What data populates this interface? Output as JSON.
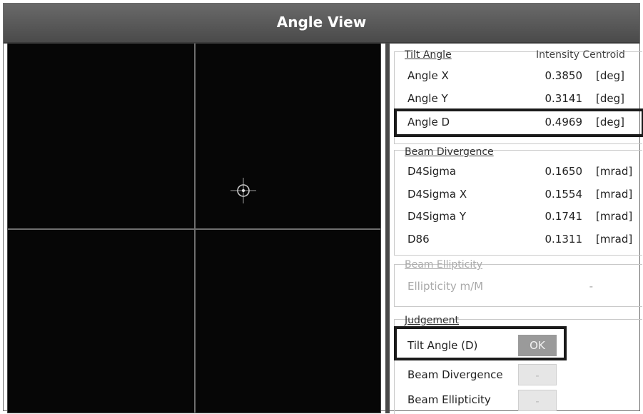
{
  "window": {
    "title": "Angle View"
  },
  "tilt_angle": {
    "group_title": "Tilt Angle",
    "method": "Intensity Centroid",
    "rows": [
      {
        "label": "Angle X",
        "value": "0.3850",
        "unit": "[deg]"
      },
      {
        "label": "Angle Y",
        "value": "0.3141",
        "unit": "[deg]"
      },
      {
        "label": "Angle D",
        "value": "0.4969",
        "unit": "[deg]"
      }
    ]
  },
  "beam_divergence": {
    "group_title": "Beam Divergence",
    "rows": [
      {
        "label": "D4Sigma",
        "value": "0.1650",
        "unit": "[mrad]"
      },
      {
        "label": "D4Sigma X",
        "value": "0.1554",
        "unit": "[mrad]"
      },
      {
        "label": "D4Sigma Y",
        "value": "0.1741",
        "unit": "[mrad]"
      },
      {
        "label": "D86",
        "value": "0.1311",
        "unit": "[mrad]"
      }
    ]
  },
  "beam_ellipticity": {
    "group_title": "Beam Ellipticity",
    "rows": [
      {
        "label": "Ellipticity m/M",
        "value": "-"
      }
    ]
  },
  "judgement": {
    "group_title": "Judgement",
    "rows": [
      {
        "label": "Tilt Angle (D)",
        "result": "OK"
      },
      {
        "label": "Beam Divergence",
        "result": "-"
      },
      {
        "label": "Beam Ellipticity",
        "result": "-"
      }
    ]
  },
  "colors": {
    "titlebar": "#555555",
    "view_background": "#060606",
    "ok_button": "#9a9a9a"
  }
}
